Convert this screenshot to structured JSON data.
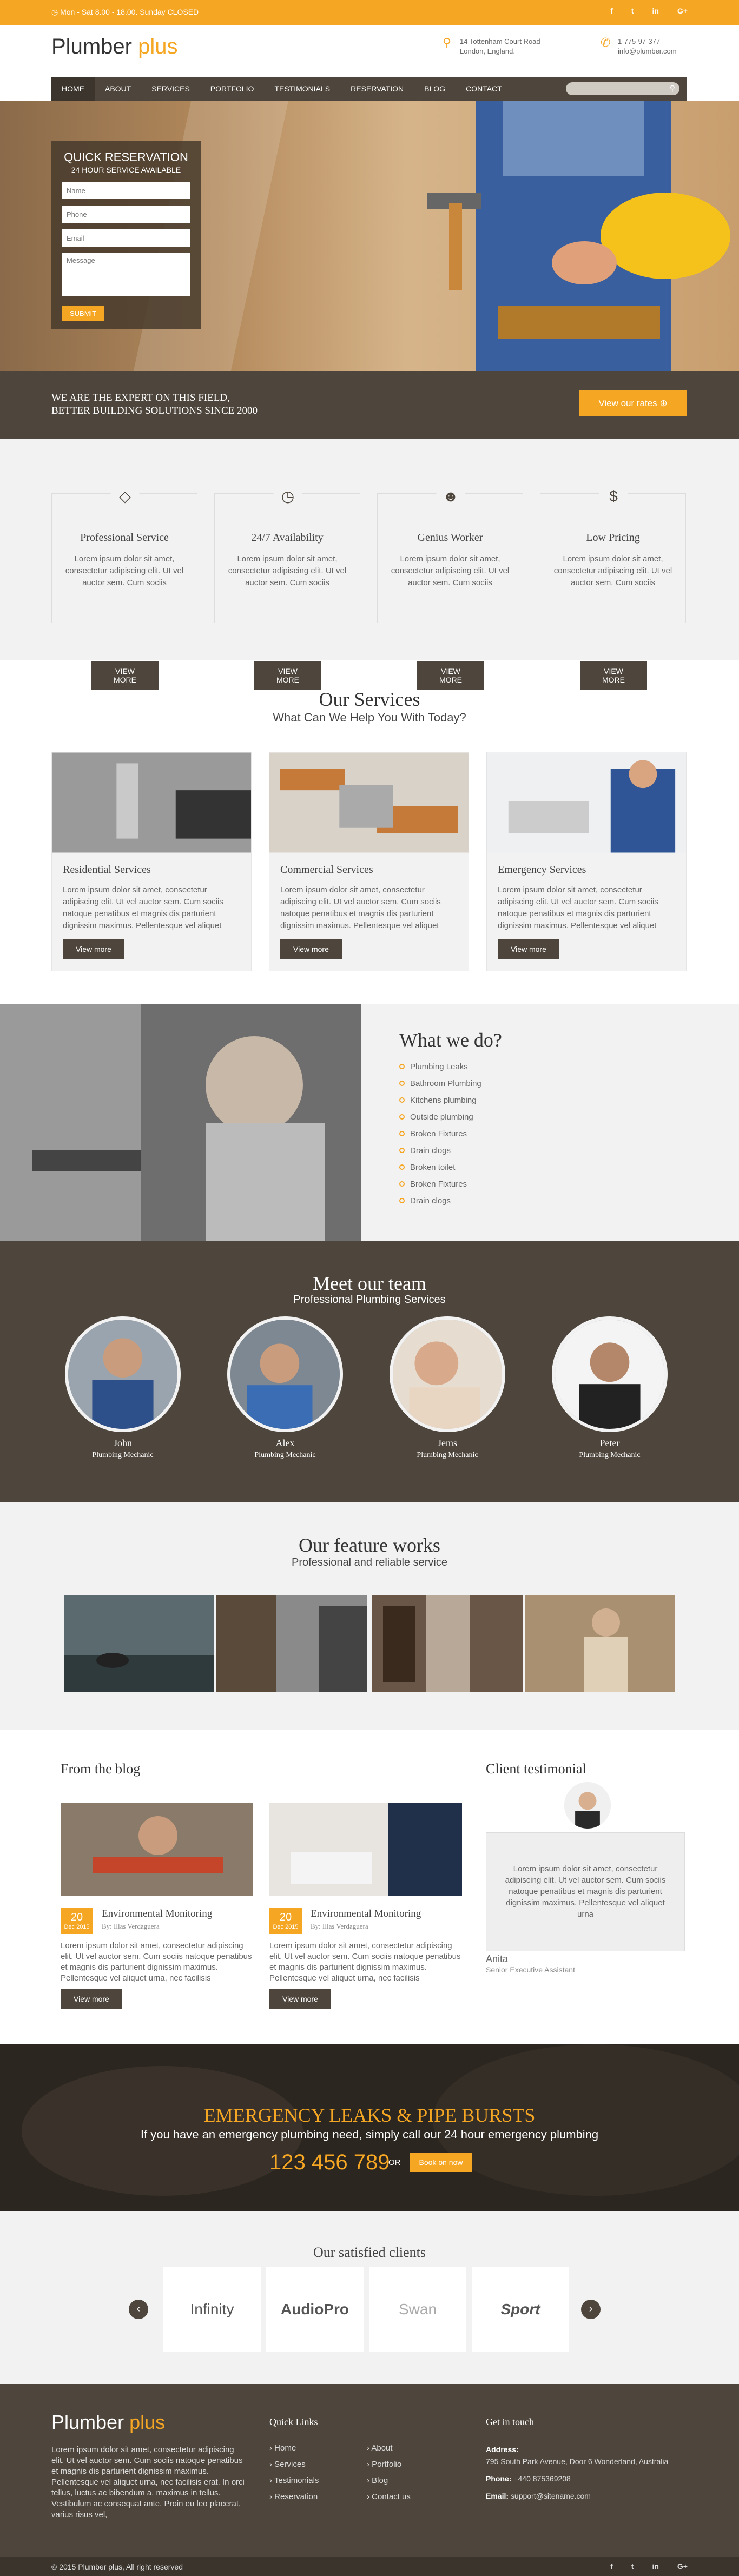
{
  "topbar": {
    "hours": "Mon - Sat 8.00 - 18.00. Sunday CLOSED",
    "social": [
      "f",
      "t",
      "in",
      "G+"
    ]
  },
  "header": {
    "logo_main": "Plumber",
    "logo_accent": "plus",
    "address1": "14 Tottenham Court Road",
    "address2": "London, England.",
    "phone": "1-775-97-377",
    "email": "info@plumber.com"
  },
  "nav": {
    "items": [
      "HOME",
      "ABOUT",
      "SERVICES",
      "PORTFOLIO",
      "TESTIMONIALS",
      "RESERVATION",
      "BLOG",
      "CONTACT"
    ]
  },
  "reservation": {
    "title": "QUICK RESERVATION",
    "subtitle": "24 HOUR SERVICE AVAILABLE",
    "name_ph": "Name",
    "phone_ph": "Phone",
    "email_ph": "Email",
    "message_ph": "Message",
    "submit": "SUBMIT"
  },
  "band": {
    "line1": "WE ARE THE EXPERT ON THIS FIELD,",
    "line2": "BETTER BUILDING SOLUTIONS SINCE 2000",
    "button": "View our rates ⊕"
  },
  "features": [
    {
      "icon": "diamond-icon",
      "title": "Professional Service",
      "text": "Lorem ipsum dolor sit amet, consectetur adipiscing elit. Ut vel auctor sem. Cum sociis",
      "button": "VIEW MORE"
    },
    {
      "icon": "clock-icon",
      "title": "24/7 Availability",
      "text": "Lorem ipsum dolor sit amet, consectetur adipiscing elit. Ut vel auctor sem. Cum sociis",
      "button": "VIEW MORE"
    },
    {
      "icon": "users-icon",
      "title": "Genius Worker",
      "text": "Lorem ipsum dolor sit amet, consectetur adipiscing elit. Ut vel auctor sem. Cum sociis",
      "button": "VIEW MORE"
    },
    {
      "icon": "dollar-icon",
      "title": "Low Pricing",
      "text": "Lorem ipsum dolor sit amet, consectetur adipiscing elit. Ut vel auctor sem. Cum sociis",
      "button": "VIEW MORE"
    }
  ],
  "services": {
    "title": "Our Services",
    "subtitle": "What Can We Help You With Today?",
    "items": [
      {
        "title": "Residential Services",
        "text": "Lorem ipsum dolor sit amet, consectetur adipiscing elit. Ut vel auctor sem. Cum sociis natoque penatibus et magnis dis parturient dignissim maximus. Pellentesque vel aliquet",
        "button": "View more"
      },
      {
        "title": "Commercial Services",
        "text": "Lorem ipsum dolor sit amet, consectetur adipiscing elit. Ut vel auctor sem. Cum sociis natoque penatibus et magnis dis parturient dignissim maximus. Pellentesque vel aliquet",
        "button": "View more"
      },
      {
        "title": "Emergency Services",
        "text": "Lorem ipsum dolor sit amet, consectetur adipiscing elit. Ut vel auctor sem. Cum sociis natoque penatibus et magnis dis parturient dignissim maximus. Pellentesque vel aliquet",
        "button": "View more"
      }
    ]
  },
  "whatwedo": {
    "title": "What we do?",
    "items": [
      "Plumbing Leaks",
      "Bathroom Plumbing",
      "Kitchens plumbing",
      "Outside plumbing",
      "Broken Fixtures",
      "Drain clogs",
      "Broken toilet",
      "Broken Fixtures",
      "Drain clogs"
    ]
  },
  "team": {
    "title": "Meet our team",
    "subtitle": "Professional Plumbing Services",
    "members": [
      {
        "name": "John",
        "role": "Plumbing Mechanic"
      },
      {
        "name": "Alex",
        "role": "Plumbing Mechanic"
      },
      {
        "name": "Jems",
        "role": "Plumbing Mechanic"
      },
      {
        "name": "Peter",
        "role": "Plumbing Mechanic"
      }
    ]
  },
  "works": {
    "title": "Our feature works",
    "subtitle": "Professional and reliable service"
  },
  "blog": {
    "title": "From the blog",
    "posts": [
      {
        "day": "20",
        "month": "Dec 2015",
        "title": "Environmental Monitoring",
        "by": "By: Illas Verdaguera",
        "text": "Lorem ipsum dolor sit amet, consectetur adipiscing elit. Ut vel auctor sem. Cum sociis natoque penatibus et magnis dis parturient dignissim maximus. Pellentesque vel aliquet urna, nec facilisis",
        "button": "View more"
      },
      {
        "day": "20",
        "month": "Dec 2015",
        "title": "Environmental Monitoring",
        "by": "By: Illas Verdaguera",
        "text": "Lorem ipsum dolor sit amet, consectetur adipiscing elit. Ut vel auctor sem. Cum sociis natoque penatibus et magnis dis parturient dignissim maximus. Pellentesque vel aliquet urna, nec facilisis",
        "button": "View more"
      }
    ]
  },
  "testimonial": {
    "title": "Client testimonial",
    "text": "Lorem ipsum dolor sit amet, consectetur adipiscing elit. Ut vel auctor sem. Cum sociis natoque penatibus et magnis dis parturient dignissim maximus. Pellentesque vel aliquet urna",
    "name": "Anita",
    "role": "Senior Executive Assistant"
  },
  "emergency": {
    "title": "EMERGENCY LEAKS & PIPE BURSTS",
    "text": "If you have an emergency plumbing need, simply call our 24 hour emergency plumbing",
    "number": "123 456 789",
    "or": "OR",
    "button": "Book on now"
  },
  "clients": {
    "title": "Our satisfied clients",
    "logos": [
      "Infinity",
      "AudioPro",
      "Swan",
      "Sport"
    ],
    "prev": "‹",
    "next": "›"
  },
  "footer": {
    "logo_main": "Plumber",
    "logo_accent": "plus",
    "about": "Lorem ipsum dolor sit amet, consectetur adipiscing elit. Ut vel auctor sem. Cum sociis natoque penatibus et magnis dis parturient dignissim maximus. Pellentesque vel aliquet urna, nec facilisis erat. In orci tellus, luctus ac bibendum a, maximus in tellus. Vestibulum ac consequat ante. Proin eu leo placerat, varius risus vel,",
    "links_title": "Quick Links",
    "links_col1": [
      "Home",
      "Services",
      "Testimonials",
      "Reservation"
    ],
    "links_col2": [
      "About",
      "Portfolio",
      "Blog",
      "Contact us"
    ],
    "touch_title": "Get in touch",
    "address_label": "Address:",
    "address": "795 South Park Avenue, Door 6 Wonderland, Australia",
    "phone_label": "Phone:",
    "phone": "+440 875369208",
    "email_label": "Email:",
    "email": "support@sitename.com"
  },
  "bottom": {
    "copyright": "© 2015 Plumber plus, All right reserved",
    "social": [
      "f",
      "t",
      "in",
      "G+"
    ]
  }
}
